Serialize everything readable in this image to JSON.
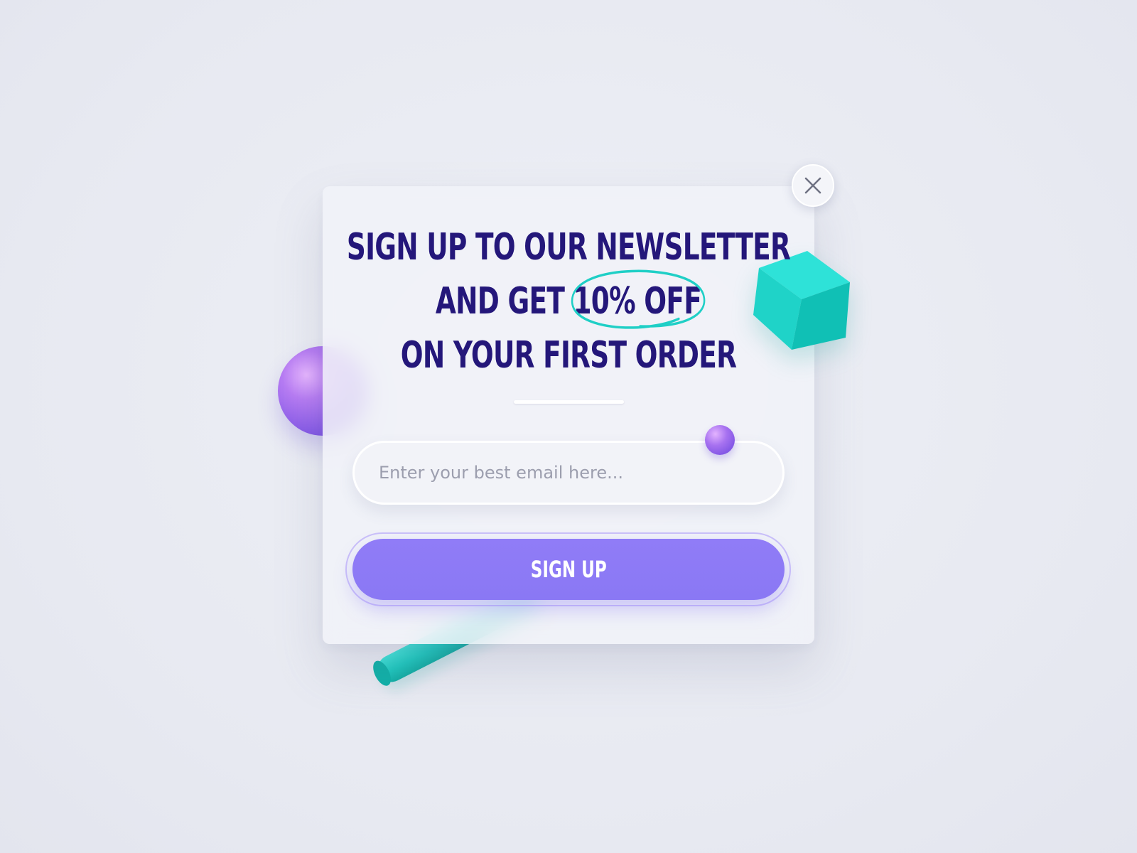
{
  "headline": {
    "line1": "SIGN UP TO OUR NEWSLETTER",
    "line2_prefix": "AND GET ",
    "line2_highlight": "10% OFF",
    "line3": "ON YOUR FIRST ORDER"
  },
  "email": {
    "placeholder": "Enter your best email here...",
    "value": ""
  },
  "signup_button": {
    "label": "SIGN UP"
  },
  "close_button": {
    "icon": "close-icon"
  },
  "colors": {
    "headline": "#24177a",
    "highlight_circle": "#1fcfc6",
    "button": "#8a78f4",
    "background": "#e8eaf2",
    "accent_teal": "#1dc9be",
    "accent_purple": "#8c5ee8"
  }
}
